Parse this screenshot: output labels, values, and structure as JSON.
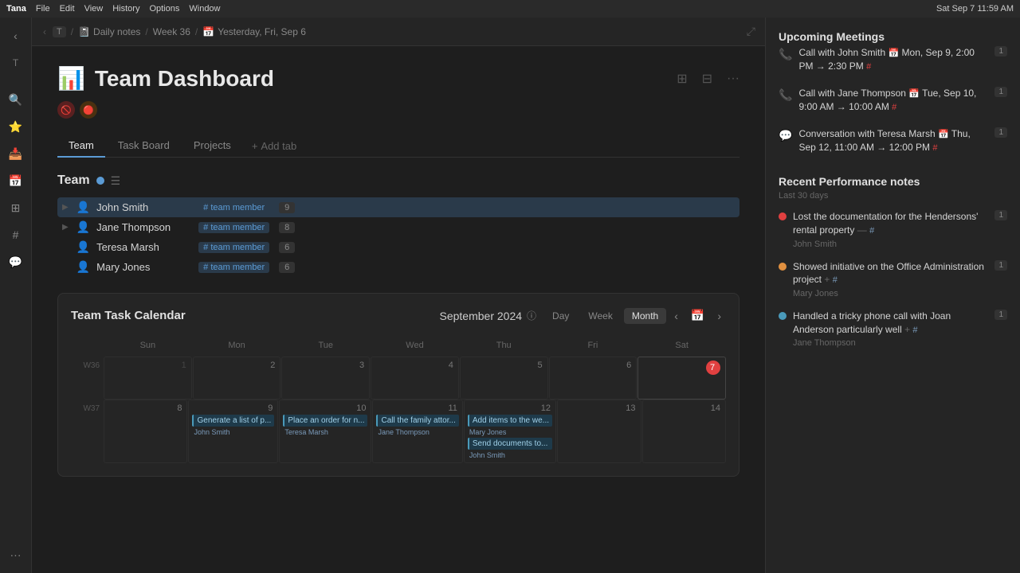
{
  "menubar": {
    "app": "Tana",
    "menus": [
      "Tana",
      "File",
      "Edit",
      "View",
      "History",
      "Options",
      "Window"
    ],
    "datetime": "Sat Sep 7  11:59 AM"
  },
  "breadcrumb": {
    "back": "‹",
    "logo": "T",
    "items": [
      {
        "label": "Daily notes",
        "icon": "📓"
      },
      {
        "label": "/"
      },
      {
        "label": "Week 36"
      },
      {
        "label": "/"
      },
      {
        "label": "Yesterday, Fri, Sep 6",
        "icon": "📅"
      }
    ]
  },
  "page": {
    "emoji": "📊",
    "title": "Team Dashboard"
  },
  "tabs": {
    "items": [
      "Team",
      "Task Board",
      "Projects"
    ],
    "active": "Team",
    "add_label": "+ Add tab"
  },
  "team_section": {
    "title": "Team",
    "members": [
      {
        "name": "John Smith",
        "tag": "# team member",
        "count": "9",
        "selected": true
      },
      {
        "name": "Jane Thompson",
        "tag": "# team member",
        "count": "8"
      },
      {
        "name": "Teresa Marsh",
        "tag": "# team member",
        "count": "6"
      },
      {
        "name": "Mary Jones",
        "tag": "# team member",
        "count": "6"
      }
    ]
  },
  "calendar": {
    "title": "Team Task Calendar",
    "month": "September 2024",
    "views": [
      "Day",
      "Week",
      "Month"
    ],
    "active_view": "Month",
    "weekdays": [
      "Sun",
      "Mon",
      "Tue",
      "Wed",
      "Thu",
      "Fri",
      "Sat"
    ],
    "weeks": [
      {
        "label": "W36",
        "days": [
          {
            "num": "",
            "empty": true
          },
          {
            "num": "2"
          },
          {
            "num": "3"
          },
          {
            "num": "4"
          },
          {
            "num": "5"
          },
          {
            "num": "6"
          },
          {
            "num": "7",
            "today": true
          }
        ]
      },
      {
        "label": "W37",
        "days": [
          {
            "num": "8"
          },
          {
            "num": "9"
          },
          {
            "num": "10"
          },
          {
            "num": "11"
          },
          {
            "num": "12"
          },
          {
            "num": "13"
          },
          {
            "num": "14"
          }
        ],
        "events": {
          "1": {
            "text": "Generate a list of p...",
            "person": "John Smith"
          },
          "2": {
            "text": "Place an order for n...",
            "person": "Teresa Marsh"
          },
          "3": {
            "text": "Call the family attor...",
            "person": "Jane Thompson"
          },
          "4": {
            "text": "Add items to the we...",
            "person": "Mary Jones"
          },
          "4b": {
            "text": "Send documents to...",
            "person": "John Smith"
          }
        }
      }
    ],
    "first_row_num": 1
  },
  "right_panel": {
    "upcoming_meetings": {
      "title": "Upcoming Meetings",
      "items": [
        {
          "icon": "📞",
          "title": "Call with John Smith",
          "time": "Mon, Sep 9, 2:00 PM → 2:30 PM",
          "hash": "#",
          "badge": "1"
        },
        {
          "icon": "📞",
          "title": "Call with Jane Thompson",
          "time": "Tue, Sep 10, 9:00 AM → 10:00 AM",
          "hash": "#",
          "badge": "1"
        },
        {
          "icon": "💬",
          "title": "Conversation with Teresa Marsh",
          "time": "Thu, Sep 12, 11:00 AM → 12:00 PM",
          "hash": "#",
          "badge": "1"
        }
      ]
    },
    "performance_notes": {
      "title": "Recent Performance notes",
      "subtitle": "Last 30 days",
      "items": [
        {
          "dot": "red",
          "text": "Lost the documentation for the Hendersons' rental property",
          "person": "John Smith",
          "badge": "1",
          "has_minus": true,
          "has_hash": true
        },
        {
          "dot": "orange",
          "text": "Showed initiative on the Office Administration project",
          "person": "Mary Jones",
          "badge": "1",
          "has_plus": true,
          "has_hash": true
        },
        {
          "dot": "blue",
          "text": "Handled a tricky phone call with Joan Anderson particularly well",
          "person": "Jane Thompson",
          "badge": "1",
          "has_plus": true,
          "has_hash": true
        }
      ]
    }
  }
}
